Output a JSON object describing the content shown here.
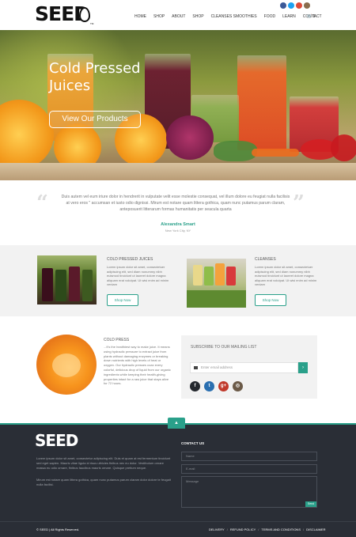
{
  "header": {
    "logo": "SEED",
    "logo_tm": "TM",
    "nav": [
      "HOME",
      "SHOP",
      "ABOUT",
      "SHOP",
      "CLEANSES SMOOTHIES",
      "FOOD",
      "LEARN",
      "CONTACT"
    ],
    "cart_count": "0",
    "social_icons": [
      "facebook-icon",
      "twitter-icon",
      "google-plus-icon",
      "instagram-icon"
    ],
    "social_colors": [
      "#3b5998",
      "#1da1f2",
      "#dd4b39",
      "#8a6d4d"
    ]
  },
  "hero": {
    "title": "Cold Pressed Juices",
    "button": "View Our Products"
  },
  "testimonial": {
    "text": "Duis autem vel eum iriure dolor in hendrerit in vulputate velit esse molestie consequat, vel illum dolore eu feugiat nulla facilisis at vero eros \" accumsan et iusto odio dignissi. Mirum est notare quam littera gothica, quam nunc putamus parum claram, anteposuerit litterarum formas humanitatis per seacula quarta",
    "name": "Alexandra Smart",
    "location": "New York City, NY"
  },
  "products": [
    {
      "title": "COLD PRESSED JUICES",
      "text": "Lorem ipsum dolor sit amet, consectetuer adipiscing elit, sed diam nonummy nibh euismod tincidunt ut laoreet dolore magna aliquam erat volutpat. Ut wisi enim ad minim veniam",
      "button": "Shop Now"
    },
    {
      "title": "CLEANSES",
      "text": "Lorem ipsum dolor sit amet, consectetuer adipiscing elit, sed diam nonummy nibh euismod tincidunt ut laoreet dolore magna aliquam erat volutpat. Ut wisi enim ad minim veniam",
      "button": "Shop Now"
    }
  ],
  "cold_press": {
    "title": "COLD PRESS",
    "text": "...It's the healthiest way to make juice. It means using hydraulic pressure to extract juice from plants without damaging enzymes or breaking down nutrients with high levels of heat or oxygen. Our hydraulic presses coax every colorful, delicious drop of liquid from our organic ingredients while keeping their health-giving properties intact for a raw juice that stays alive for 72 hours."
  },
  "mailing": {
    "title": "SUBSCRIBE TO OUR MAILING LIST",
    "placeholder": "Enter email address",
    "submit": "›",
    "social_icons": [
      "facebook-icon",
      "twitter-icon",
      "google-plus-icon",
      "instagram-icon"
    ],
    "social_glyphs": [
      "f",
      "t",
      "g+",
      "◎"
    ],
    "social_colors": [
      "#24282e",
      "#2a6fb0",
      "#c0392b",
      "#6b5a48"
    ]
  },
  "footer": {
    "logo": "SEED",
    "para1": "Lorem ipsum dolor sit amet, consectetur adipiscing elit. Duis et quam at est fermentum tincidunt sed eget sapien. Mauris vitae ligula id risus ultricies finibus nec eu dolor. Vestibulum ornare massa eu odio ornare, finibus faucibus mauris ornare. Quisque pretium neque.",
    "para2": "Mirum est notare quam littera gothica, quam nunc putamus parum claram dolor dolore te feugait nulla facilisi.",
    "contact_title": "CONTACT US",
    "name_placeholder": "Name",
    "email_placeholder": "E-mail",
    "message_placeholder": "Message",
    "send": "Send",
    "copyright": "© SEED | All Rights Reserved.",
    "links": [
      "DELIVERY",
      "REFUND POLICY",
      "TERMS AND CONDITIONS",
      "DISCLAIMER"
    ]
  },
  "scroll_top": "▲"
}
